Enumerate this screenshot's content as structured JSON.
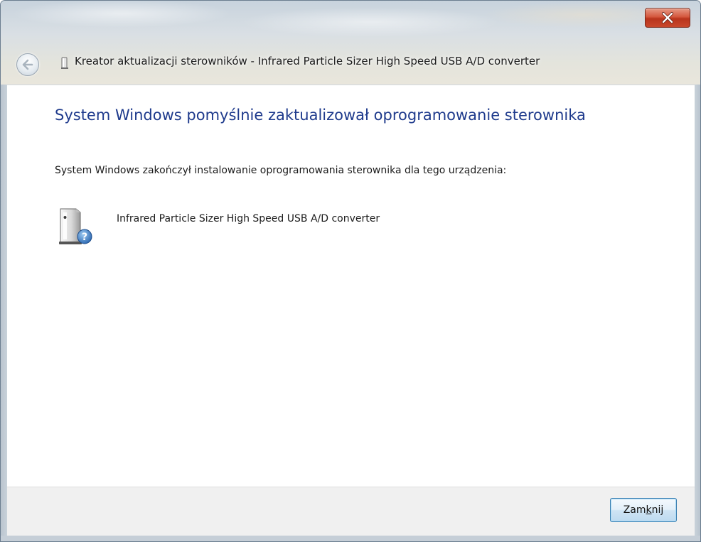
{
  "window": {
    "title": "Kreator aktualizacji sterowników - Infrared Particle Sizer High Speed USB A/D converter"
  },
  "content": {
    "headline": "System Windows pomyślnie zaktualizował oprogramowanie sterownika",
    "message": "System Windows zakończył instalowanie oprogramowania sterownika dla tego urządzenia:",
    "device_name": "Infrared Particle Sizer High Speed USB A/D converter"
  },
  "footer": {
    "close_label_before": "Zam",
    "close_label_accel": "k",
    "close_label_after": "nij"
  },
  "icons": {
    "titlebar": "device-icon",
    "back": "back-arrow-icon",
    "close": "close-x-icon",
    "device": "device-unknown-icon"
  },
  "colors": {
    "headline": "#1e3a8c",
    "close_button": "#c9472b",
    "footer_bg": "#f0f0f0"
  }
}
